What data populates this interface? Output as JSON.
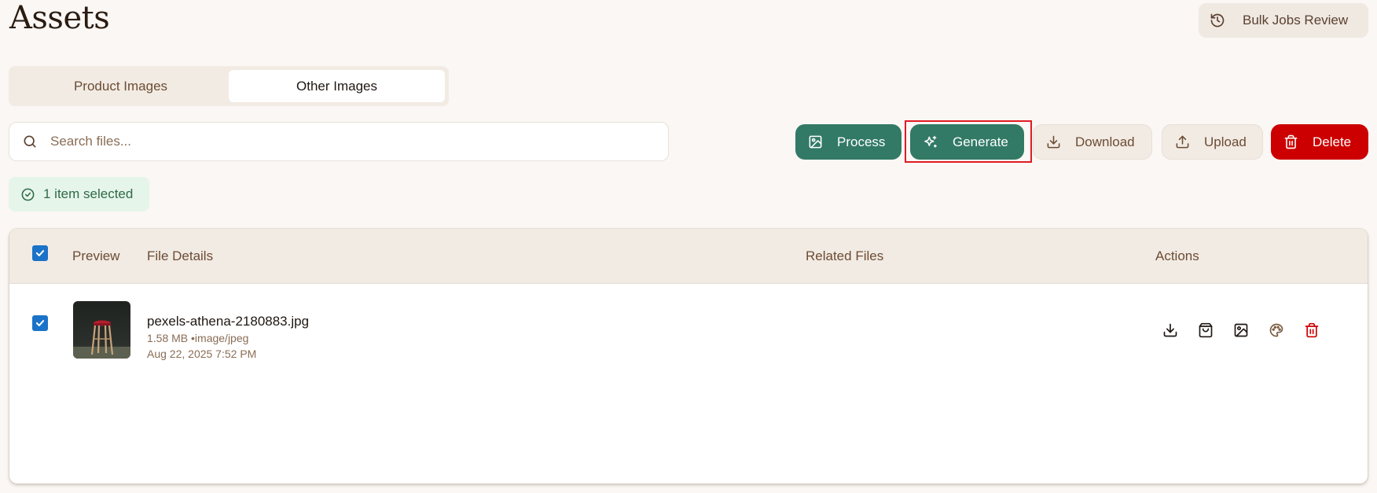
{
  "page": {
    "title": "Assets"
  },
  "header": {
    "bulk_jobs_label": "Bulk Jobs Review"
  },
  "tabs": [
    {
      "label": "Product Images",
      "active": false
    },
    {
      "label": "Other Images",
      "active": true
    }
  ],
  "search": {
    "placeholder": "Search files...",
    "value": ""
  },
  "toolbar": {
    "process_label": "Process",
    "generate_label": "Generate",
    "download_label": "Download",
    "upload_label": "Upload",
    "delete_label": "Delete"
  },
  "selection": {
    "status_text": "1 item selected"
  },
  "table": {
    "columns": {
      "preview": "Preview",
      "file_details": "File Details",
      "related_files": "Related Files",
      "actions": "Actions"
    },
    "rows": [
      {
        "checked": true,
        "file_name": "pexels-athena-2180883.jpg",
        "meta": "1.58 MB •image/jpeg",
        "date": "Aug 22, 2025 7:52 PM",
        "actions": [
          "download-icon",
          "shopping-bag-icon",
          "image-icon",
          "palette-icon",
          "trash-icon"
        ]
      }
    ]
  },
  "colors": {
    "primary_green": "#327a66",
    "danger_red": "#cc0000",
    "checkbox_blue": "#1a73c8",
    "background": "#faf7f4"
  }
}
